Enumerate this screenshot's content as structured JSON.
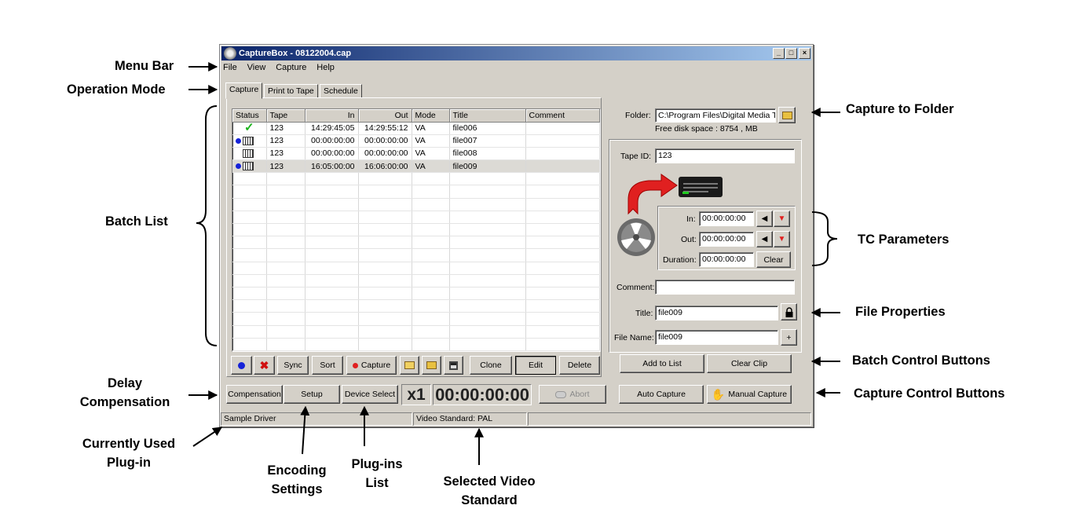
{
  "annotations": {
    "menu_bar": "Menu Bar",
    "operation_mode": "Operation Mode",
    "batch_list": "Batch List",
    "delay_compensation_1": "Delay",
    "delay_compensation_2": "Compensation",
    "currently_used_plugin_1": "Currently Used",
    "currently_used_plugin_2": "Plug-in",
    "encoding_settings_1": "Encoding",
    "encoding_settings_2": "Settings",
    "plugins_list_1": "Plug-ins",
    "plugins_list_2": "List",
    "selected_video_standard_1": "Selected Video",
    "selected_video_standard_2": "Standard",
    "capture_to_folder": "Capture to Folder",
    "tc_parameters": "TC Parameters",
    "file_properties": "File Properties",
    "batch_control_buttons": "Batch Control Buttons",
    "capture_control_buttons": "Capture Control Buttons"
  },
  "window": {
    "title": "CaptureBox - 08122004.cap",
    "minimize": "_",
    "maximize": "□",
    "close": "×"
  },
  "menu": [
    "File",
    "View",
    "Capture",
    "Help"
  ],
  "tabs": [
    "Capture",
    "Print to Tape",
    "Schedule"
  ],
  "batch_list": {
    "columns": [
      "Status",
      "Tape",
      "In",
      "Out",
      "Mode",
      "Title",
      "Comment"
    ],
    "rows": [
      {
        "status": "done",
        "tape": "123",
        "in": "14:29:45:05",
        "out": "14:29:55:12",
        "mode": "VA",
        "title": "file006",
        "comment": ""
      },
      {
        "status": "queued",
        "tape": "123",
        "in": "00:00:00:00",
        "out": "00:00:00:00",
        "mode": "VA",
        "title": "file007",
        "comment": ""
      },
      {
        "status": "clip",
        "tape": "123",
        "in": "00:00:00:00",
        "out": "00:00:00:00",
        "mode": "VA",
        "title": "file008",
        "comment": ""
      },
      {
        "status": "queued",
        "tape": "123",
        "in": "16:05:00:00",
        "out": "16:06:00:00",
        "mode": "VA",
        "title": "file009",
        "comment": ""
      }
    ]
  },
  "list_toolbar": {
    "sync": "Sync",
    "sort": "Sort",
    "capture": "Capture",
    "clone": "Clone",
    "edit": "Edit",
    "delete": "Delete"
  },
  "bottom_bar": {
    "compensation": "Compensation",
    "setup": "Setup",
    "device_select": "Device Select",
    "speed": "x1",
    "timecode": "00:00:00:00",
    "abort": "Abort",
    "auto_capture": "Auto Capture",
    "manual_capture": "Manual Capture"
  },
  "folder": {
    "label": "Folder:",
    "path": "C:\\Program Files\\Digital Media T",
    "free_space": "Free disk space : 8754 , MB"
  },
  "tape": {
    "label": "Tape ID:",
    "value": "123"
  },
  "tc": {
    "in_label": "In:",
    "in_value": "00:00:00:00",
    "out_label": "Out:",
    "out_value": "00:00:00:00",
    "duration_label": "Duration:",
    "duration_value": "00:00:00:00",
    "clear": "Clear"
  },
  "properties": {
    "comment_label": "Comment:",
    "comment_value": "",
    "title_label": "Title:",
    "title_value": "file009",
    "filename_label": "File Name:",
    "filename_value": "file009",
    "plus": "+"
  },
  "batch_controls": {
    "add_to_list": "Add to List",
    "clear_clip": "Clear Clip"
  },
  "status_bar": {
    "driver": "Sample Driver",
    "video_standard": "Video Standard: PAL"
  },
  "colors": {
    "title_start": "#0a246a",
    "title_end": "#a6caf0",
    "record_dot": "#1522d8",
    "check": "#1bb31b",
    "arrow_red": "#e02020"
  }
}
